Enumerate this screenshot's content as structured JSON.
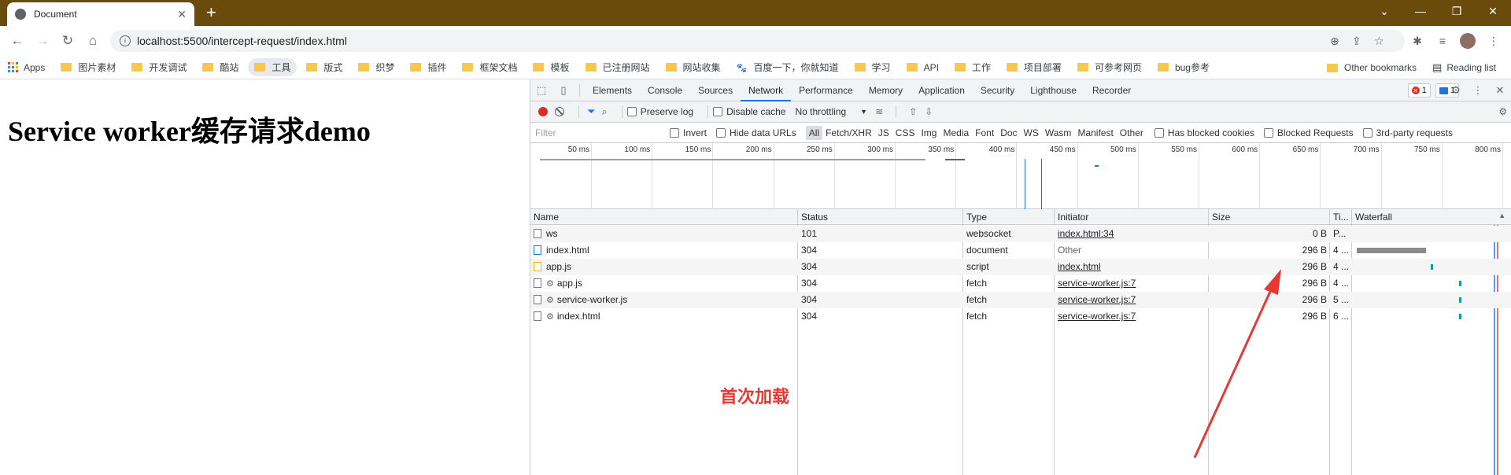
{
  "browser": {
    "tab_title": "Document",
    "new_tab": "+",
    "url": "localhost:5500/intercept-request/index.html"
  },
  "bookmarks": {
    "apps": "Apps",
    "items": [
      "图片素材",
      "开发调试",
      "酷站",
      "工具",
      "版式",
      "织梦",
      "插件",
      "框架文档",
      "模板",
      "已注册网站",
      "网站收集",
      "百度一下，你就知道",
      "学习",
      "API",
      "工作",
      "项目部署",
      "可参考网页",
      "bug参考"
    ],
    "other": "Other bookmarks",
    "reading": "Reading list"
  },
  "page": {
    "heading": "Service worker缓存请求demo"
  },
  "devtools": {
    "tabs": [
      "Elements",
      "Console",
      "Sources",
      "Network",
      "Performance",
      "Memory",
      "Application",
      "Security",
      "Lighthouse",
      "Recorder"
    ],
    "active_tab": "Network",
    "errors": "1",
    "messages": "1",
    "preserve_log": "Preserve log",
    "disable_cache": "Disable cache",
    "throttling": "No throttling",
    "filter_placeholder": "Filter",
    "invert": "Invert",
    "hide_data_urls": "Hide data URLs",
    "types": [
      "All",
      "Fetch/XHR",
      "JS",
      "CSS",
      "Img",
      "Media",
      "Font",
      "Doc",
      "WS",
      "Wasm",
      "Manifest",
      "Other"
    ],
    "has_blocked_cookies": "Has blocked cookies",
    "blocked_requests": "Blocked Requests",
    "third_party": "3rd-party requests",
    "ticks": [
      "50 ms",
      "100 ms",
      "150 ms",
      "200 ms",
      "250 ms",
      "300 ms",
      "350 ms",
      "400 ms",
      "450 ms",
      "500 ms",
      "550 ms",
      "600 ms",
      "650 ms",
      "700 ms",
      "750 ms",
      "800 ms"
    ],
    "columns": {
      "name": "Name",
      "status": "Status",
      "type": "Type",
      "initiator": "Initiator",
      "size": "Size",
      "time": "Ti...",
      "waterfall": "Waterfall"
    },
    "rows": [
      {
        "name": "ws",
        "status": "101",
        "type": "websocket",
        "initiator": "index.html:34",
        "size": "0 B",
        "time": "P...",
        "icon": "file-icon",
        "gear": false,
        "initiator_link": true
      },
      {
        "name": "index.html",
        "status": "304",
        "type": "document",
        "initiator": "Other",
        "size": "296 B",
        "time": "4 ...",
        "icon": "document-icon",
        "gear": false,
        "initiator_link": false
      },
      {
        "name": "app.js",
        "status": "304",
        "type": "script",
        "initiator": "index.html",
        "size": "296 B",
        "time": "4 ...",
        "icon": "script-icon",
        "gear": false,
        "initiator_link": true
      },
      {
        "name": "app.js",
        "status": "304",
        "type": "fetch",
        "initiator": "service-worker.js:7",
        "size": "296 B",
        "time": "4 ...",
        "icon": "file-icon",
        "gear": true,
        "initiator_link": true
      },
      {
        "name": "service-worker.js",
        "status": "304",
        "type": "fetch",
        "initiator": "service-worker.js:7",
        "size": "296 B",
        "time": "5 ...",
        "icon": "file-icon",
        "gear": true,
        "initiator_link": true
      },
      {
        "name": "index.html",
        "status": "304",
        "type": "fetch",
        "initiator": "service-worker.js:7",
        "size": "296 B",
        "time": "6 ...",
        "icon": "file-icon",
        "gear": true,
        "initiator_link": true
      }
    ]
  },
  "annotation": {
    "text": "首次加载",
    "color": "#e53935"
  }
}
